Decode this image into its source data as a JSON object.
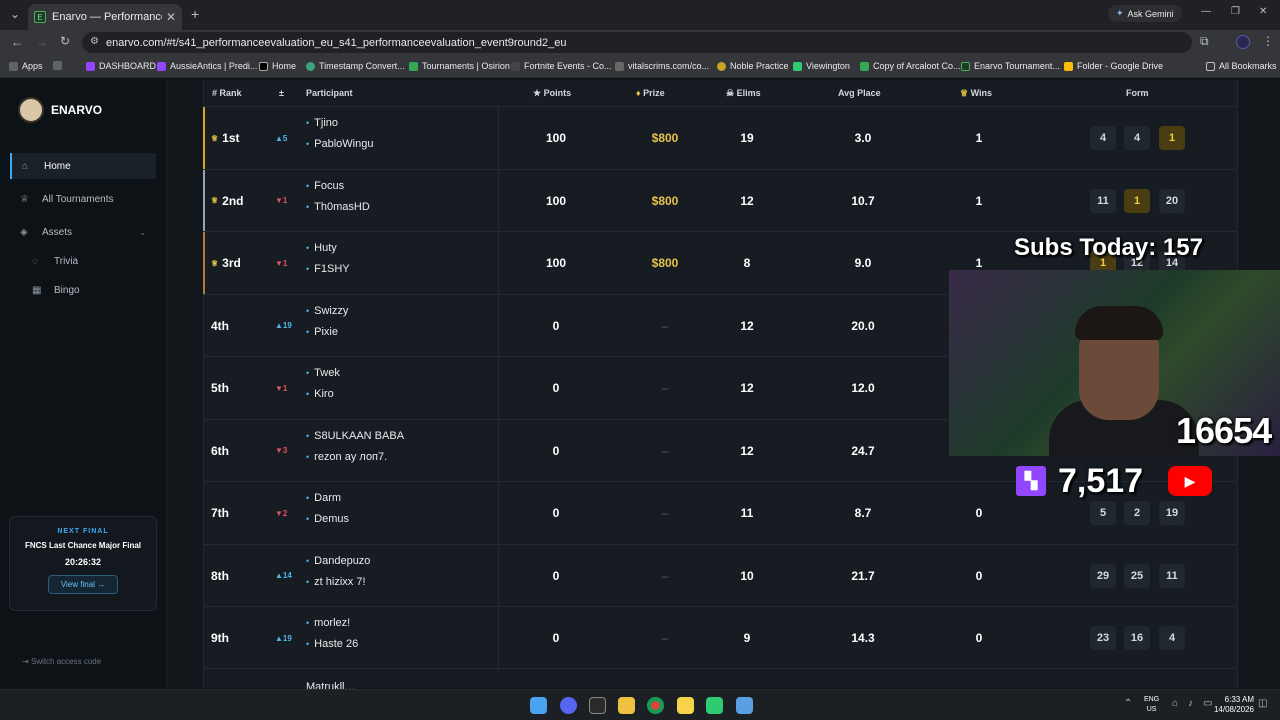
{
  "browser": {
    "tab_title": "Enarvo — Performance Evaluati",
    "url": "enarvo.com/#t/s41_performanceevaluation_eu_s41_performanceevaluation_event9round2_eu",
    "ask_gemini": "Ask Gemini",
    "bookmarks": [
      "Apps",
      "DASHBOARD",
      "AussieAntics | Predi...",
      "Home",
      "Timestamp Convert...",
      "Tournaments | Osirion",
      "Fortnite Events - Co...",
      "vitalscrims.com/co...",
      "Noble Practice",
      "Viewington",
      "Copy of Arcaloot Co...",
      "Enarvo Tournament...",
      "Folder - Google Drive"
    ],
    "all_bookmarks": "All Bookmarks"
  },
  "sidebar": {
    "brand": "ENARVO",
    "items": [
      {
        "label": "Home"
      },
      {
        "label": "All Tournaments"
      },
      {
        "label": "Assets"
      },
      {
        "label": "Trivia"
      },
      {
        "label": "Bingo"
      }
    ],
    "next_final": {
      "kicker": "NEXT FINAL",
      "title": "FNCS Last Chance Major Final",
      "countdown": "20:26:32",
      "button": "View final →"
    },
    "switch_code": "Switch access code"
  },
  "table": {
    "headers": {
      "rank": "# Rank",
      "change": "±",
      "participant": "Participant",
      "points": "★ Points",
      "prize": "Prize",
      "elims": "Elims",
      "avg_place": "Avg Place",
      "wins": "Wins",
      "form": "Form"
    },
    "rows": [
      {
        "rank": "1st",
        "change": "▲5",
        "dir": "up",
        "p1": "Tjino",
        "p2": "PabloWingu",
        "points": "100",
        "prize": "$800",
        "elims": "19",
        "avg": "3.0",
        "wins": "1",
        "form": [
          "4",
          "4",
          "1"
        ],
        "gold": 2,
        "accent": "#d4a628"
      },
      {
        "rank": "2nd",
        "change": "▼1",
        "dir": "down",
        "p1": "Focus",
        "p2": "Th0masHD",
        "points": "100",
        "prize": "$800",
        "elims": "12",
        "avg": "10.7",
        "wins": "1",
        "form": [
          "11",
          "1",
          "20"
        ],
        "gold": 1,
        "accent": "#9aa4ad"
      },
      {
        "rank": "3rd",
        "change": "▼1",
        "dir": "down",
        "p1": "Huty",
        "p2": "F1SHY",
        "points": "100",
        "prize": "$800",
        "elims": "8",
        "avg": "9.0",
        "wins": "1",
        "form": [
          "1",
          "12",
          "14"
        ],
        "gold": 0,
        "accent": "#b07a3a"
      },
      {
        "rank": "4th",
        "change": "▲19",
        "dir": "up",
        "p1": "Swizzy",
        "p2": "Pixie",
        "points": "0",
        "prize": "–",
        "elims": "12",
        "avg": "20.0",
        "wins": "",
        "form": [],
        "gold": -1,
        "accent": ""
      },
      {
        "rank": "5th",
        "change": "▼1",
        "dir": "down",
        "p1": "Twek",
        "p2": "Kiro",
        "points": "0",
        "prize": "–",
        "elims": "12",
        "avg": "12.0",
        "wins": "",
        "form": [],
        "gold": -1,
        "accent": ""
      },
      {
        "rank": "6th",
        "change": "▼3",
        "dir": "down",
        "p1": "S8ULKAAN BABA",
        "p2": "rezon ay лоп7.",
        "points": "0",
        "prize": "–",
        "elims": "12",
        "avg": "24.7",
        "wins": "",
        "form": [],
        "gold": -1,
        "accent": ""
      },
      {
        "rank": "7th",
        "change": "▼2",
        "dir": "down",
        "p1": "Darm",
        "p2": "Demus",
        "points": "0",
        "prize": "–",
        "elims": "11",
        "avg": "8.7",
        "wins": "0",
        "form": [
          "5",
          "2",
          "19"
        ],
        "gold": -1,
        "accent": ""
      },
      {
        "rank": "8th",
        "change": "▲14",
        "dir": "up",
        "p1": "Dandepuzo",
        "p2": "zt hizixx 7!",
        "points": "0",
        "prize": "–",
        "elims": "10",
        "avg": "21.7",
        "wins": "0",
        "form": [
          "29",
          "25",
          "11"
        ],
        "gold": -1,
        "accent": ""
      },
      {
        "rank": "9th",
        "change": "▲19",
        "dir": "up",
        "p1": "morlez!",
        "p2": "Haste 26",
        "points": "0",
        "prize": "–",
        "elims": "9",
        "avg": "14.3",
        "wins": "0",
        "form": [
          "23",
          "16",
          "4"
        ],
        "gold": -1,
        "accent": ""
      }
    ],
    "partial_row_name": "Matrukll…"
  },
  "overlay": {
    "subs_today": "Subs Today: 157",
    "count_a": "16654",
    "count_b": "7,517"
  },
  "taskbar": {
    "lang": "ENG",
    "region": "US",
    "time": "6:33 AM",
    "date": "14/08/2026"
  }
}
